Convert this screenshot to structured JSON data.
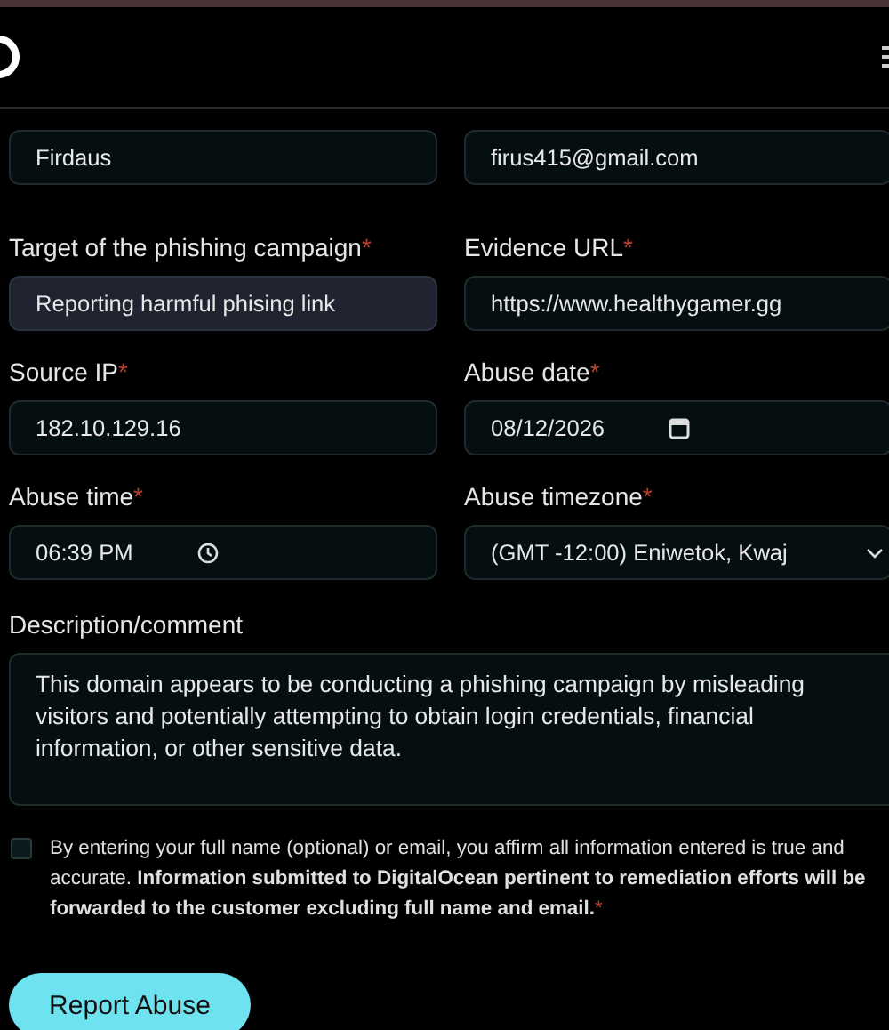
{
  "fields": [
    {
      "kind": "text",
      "value": "Firdaus",
      "focused": false
    },
    {
      "kind": "text",
      "value": "firus415@gmail.com",
      "focused": false
    },
    {
      "kind": "text",
      "label": "Target of the phishing campaign",
      "required_mark": "*",
      "value": "Reporting harmful phising link",
      "focused": true
    },
    {
      "kind": "text",
      "label": "Evidence URL",
      "required_mark": "*",
      "value": "https://www.healthygamer.gg",
      "focused": false
    },
    {
      "kind": "text",
      "label": "Source IP",
      "required_mark": "*",
      "value": "182.10.129.16",
      "focused": false
    },
    {
      "kind": "date",
      "label": "Abuse date",
      "required_mark": "*",
      "value": "08/12/2026",
      "focused": false
    },
    {
      "kind": "time",
      "label": "Abuse time",
      "required_mark": "*",
      "value": "06:39 PM",
      "focused": false
    },
    {
      "kind": "select",
      "label": "Abuse timezone",
      "required_mark": "*",
      "value": "(GMT -12:00) Eniwetok, Kwaj",
      "focused": false
    }
  ],
  "description": {
    "label": "Description/comment",
    "value": "This domain appears to be conducting a phishing campaign by misleading visitors and potentially attempting to obtain login credentials, financial information, or other sensitive data."
  },
  "consent": {
    "checked": false,
    "text": "By entering your full name (optional) or email, you affirm all information entered is true and accurate. **Information submitted to DigitalOcean pertinent to remediation efforts will be forwarded to the customer excluding full name and email.**",
    "required_mark": "*"
  },
  "submit": "Report Abuse"
}
